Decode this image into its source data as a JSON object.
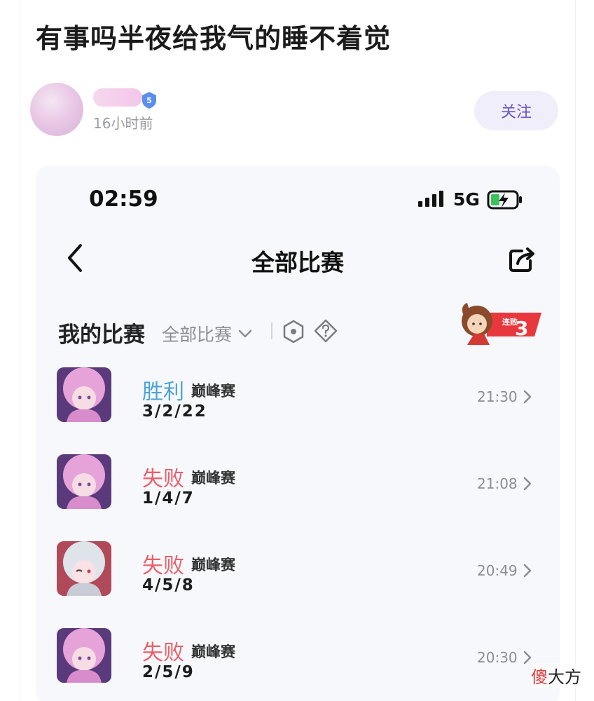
{
  "post": {
    "title": "有事吗半夜给我气的睡不着觉",
    "author": {
      "level": "5",
      "time": "16小时前"
    },
    "follow_label": "关注"
  },
  "screenshot": {
    "status_bar": {
      "time": "02:59",
      "network": "5G",
      "icons": [
        "signal-icon",
        "battery-charging-icon"
      ]
    },
    "nav": {
      "title": "全部比赛",
      "icons": [
        "back-icon",
        "share-icon"
      ]
    },
    "section": {
      "title": "我的比赛",
      "filter": "全部比赛",
      "icons": [
        "chevron-down-icon",
        "hexagon-icon",
        "help-icon"
      ],
      "streak": {
        "label": "连败",
        "count": "3",
        "color": "#e8383d"
      }
    },
    "matches": [
      {
        "result": "胜利",
        "result_type": "win",
        "mode": "巅峰赛",
        "kda": "3/2/22",
        "time": "21:30",
        "hero_avatar": "pink-hair-hero"
      },
      {
        "result": "失败",
        "result_type": "loss",
        "mode": "巅峰赛",
        "kda": "1/4/7",
        "time": "21:08",
        "hero_avatar": "pink-hair-hero"
      },
      {
        "result": "失败",
        "result_type": "loss",
        "mode": "巅峰赛",
        "kda": "4/5/8",
        "time": "20:49",
        "hero_avatar": "silver-hair-hero"
      },
      {
        "result": "失败",
        "result_type": "loss",
        "mode": "巅峰赛",
        "kda": "2/5/9",
        "time": "20:30",
        "hero_avatar": "pink-hair-hero"
      }
    ],
    "colors": {
      "win": "#4aa3d8",
      "loss": "#e8606a"
    }
  },
  "watermark": {
    "brand": "傻",
    "rest": "大方"
  }
}
